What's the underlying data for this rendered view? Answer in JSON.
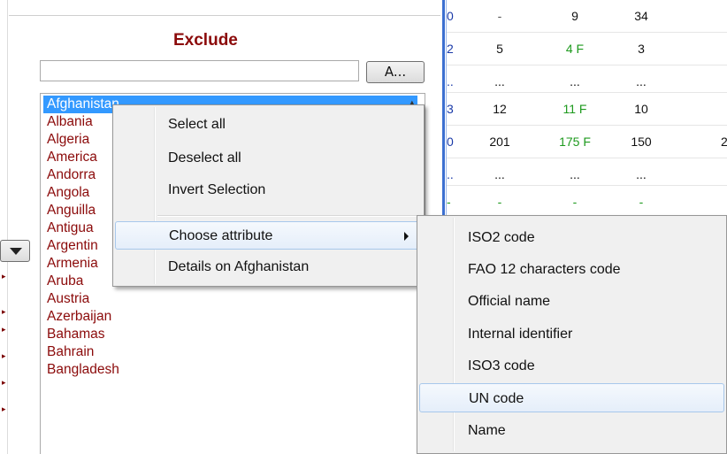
{
  "panel": {
    "title": "Exclude",
    "filter_value": "",
    "a_button_label": "A..."
  },
  "countries": [
    "Afghanistan",
    "Albania",
    "Algeria",
    "America",
    "Andorra",
    "Angola",
    "Anguilla",
    "Antigua",
    "Argentin",
    "Armenia",
    "Aruba",
    "Austria",
    "Azerbaijan",
    "Bahamas",
    "Bahrain",
    "Bangladesh"
  ],
  "selected_country": "Afghanistan",
  "grid": {
    "rows": [
      {
        "first": "0",
        "c1": "-",
        "c2": "9",
        "c3": "34",
        "c4": ""
      },
      {
        "first": "2",
        "c1": "5",
        "c2": "4 F",
        "c3": "3",
        "c4": ""
      },
      {
        "first": "..",
        "c1": "...",
        "c2": "...",
        "c3": "...",
        "c4": ""
      },
      {
        "first": "3",
        "c1": "12",
        "c2": "11 F",
        "c3": "10",
        "c4": ""
      },
      {
        "first": "0",
        "c1": "201",
        "c2": "175 F",
        "c3": "150",
        "c4": "2"
      },
      {
        "first": "..",
        "c1": "...",
        "c2": "...",
        "c3": "...",
        "c4": ""
      },
      {
        "first": "-",
        "c1": "-",
        "c2": "-",
        "c3": "-",
        "c4": ""
      }
    ]
  },
  "context_menu": {
    "items": [
      {
        "label": "Select all"
      },
      {
        "label": "Deselect all"
      },
      {
        "label": "Invert Selection"
      },
      {
        "label": "Choose attribute",
        "has_submenu": true
      },
      {
        "label": "Details on Afghanistan"
      }
    ]
  },
  "submenu": {
    "items": [
      {
        "label": "ISO2 code"
      },
      {
        "label": "FAO 12 characters code"
      },
      {
        "label": "Official name"
      },
      {
        "label": "Internal identifier"
      },
      {
        "label": "ISO3 code"
      },
      {
        "label": "UN code",
        "highlighted": true
      },
      {
        "label": "Name"
      }
    ]
  },
  "colors": {
    "title": "#8b0a0a",
    "country_text": "#8b0a0a",
    "selection": "#3399ff",
    "grid_divider": "#3b6fd1",
    "flag_green": "#1e9a1e"
  }
}
